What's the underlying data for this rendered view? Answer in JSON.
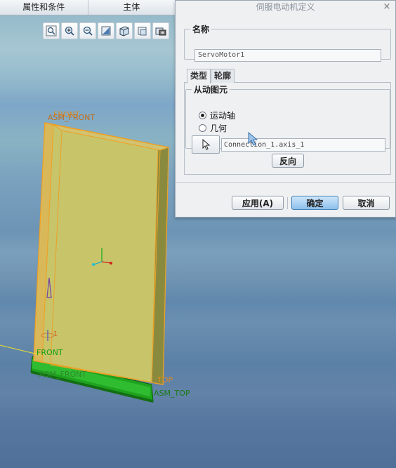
{
  "top_tabs": [
    "属性和条件",
    "主体"
  ],
  "view_toolbar": {
    "icons": [
      "zoom-window-icon",
      "zoom-in-icon",
      "zoom-out-icon",
      "refit-icon",
      "view-orientation-icon",
      "saved-views-icon",
      "display-style-icon"
    ]
  },
  "dialog": {
    "title": "伺服电动机定义",
    "close_glyph": "×",
    "name_group": {
      "label": "名称",
      "value": "ServoMotor1"
    },
    "tabs": [
      {
        "label": "类型",
        "active": true
      },
      {
        "label": "轮廓",
        "active": false
      }
    ],
    "follower_group": {
      "label": "从动图元",
      "options": [
        {
          "label": "运动轴",
          "checked": true
        },
        {
          "label": "几何",
          "checked": false
        }
      ],
      "reference_value": "Connection_1.axis_1"
    },
    "flip_label": "反向",
    "buttons": {
      "apply": "应用(A)",
      "ok": "确定",
      "cancel": "取消"
    }
  },
  "viewport": {
    "labels": {
      "asm_front": "ASM_FRONT",
      "front": "FRONT",
      "front_lower": "FRONT",
      "asm_front_lower": "ASM_FRONT",
      "top": "TOP",
      "asm_top": "ASM_TOP",
      "connection_label": "1"
    },
    "colors": {
      "part_face": "#c8c46a",
      "part_edge": "#f0a020",
      "base": "#2dbb2d",
      "datum_green": "#1c9a1c"
    }
  }
}
